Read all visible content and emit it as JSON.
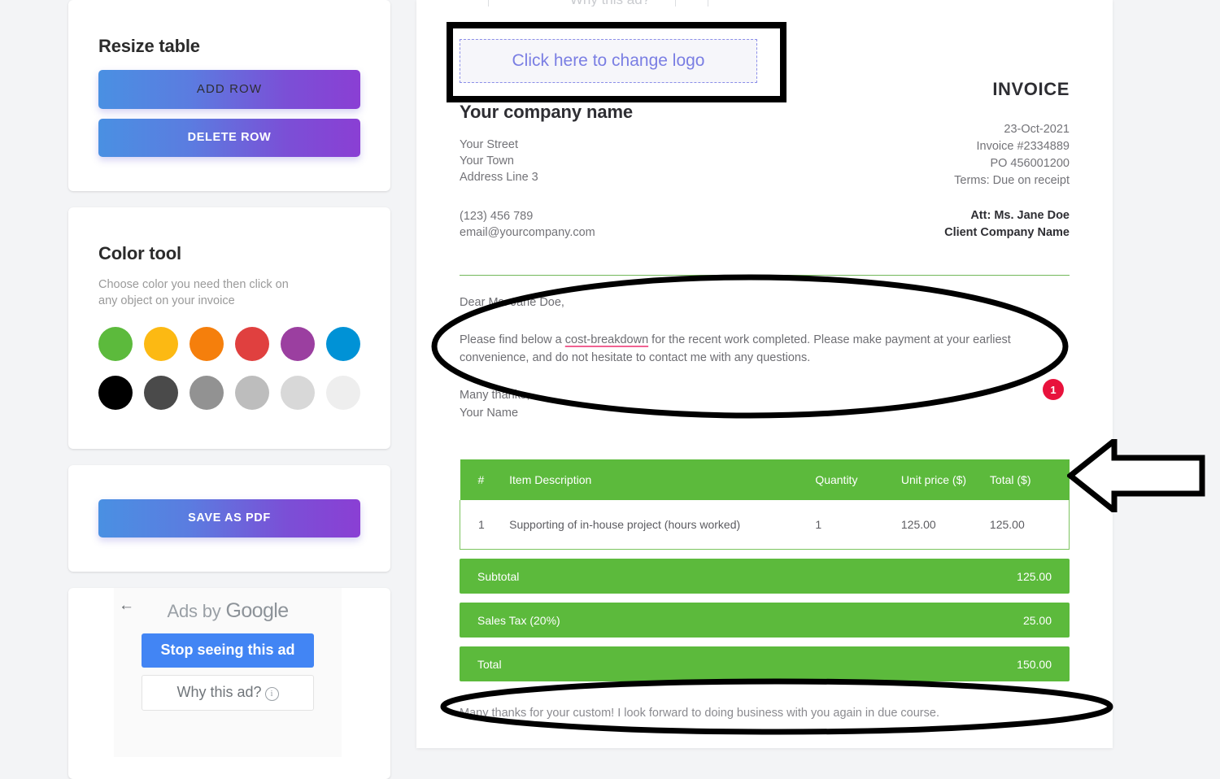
{
  "sidebar": {
    "resize_panel": {
      "title": "Resize table",
      "add_row_label": "ADD ROW",
      "delete_row_label": "DELETE ROW"
    },
    "color_panel": {
      "title": "Color tool",
      "subtitle": "Choose color you need then click on any object on your invoice",
      "swatches": [
        {
          "name": "green",
          "hex": "#5cba3c"
        },
        {
          "name": "yellow",
          "hex": "#fcb913"
        },
        {
          "name": "orange",
          "hex": "#f57f0c"
        },
        {
          "name": "red",
          "hex": "#e0403f"
        },
        {
          "name": "purple",
          "hex": "#9b3fa0"
        },
        {
          "name": "blue",
          "hex": "#0092d6"
        },
        {
          "name": "black",
          "hex": "#000000"
        },
        {
          "name": "dark-gray",
          "hex": "#4a4a4a"
        },
        {
          "name": "gray",
          "hex": "#929292"
        },
        {
          "name": "light-gray",
          "hex": "#bdbdbd"
        },
        {
          "name": "lighter-gray",
          "hex": "#d8d8d8"
        },
        {
          "name": "near-white",
          "hex": "#eeeeee"
        }
      ]
    },
    "save_panel": {
      "save_as_pdf_label": "SAVE AS PDF"
    },
    "ad_panel": {
      "back_arrow": "←",
      "ads_by_prefix": "Ads by ",
      "ads_by_brand": "Google",
      "stop_seeing_label": "Stop seeing this ad",
      "why_this_ad_label": "Why this ad?",
      "info_glyph": "i"
    }
  },
  "top_ghost_text": "Why this ad?",
  "invoice": {
    "logo_placeholder": "Click here to change logo",
    "company_name": "Your company name",
    "address_lines": [
      "Your Street",
      "Your Town",
      "Address Line 3"
    ],
    "contact_lines": [
      "(123) 456 789",
      "email@yourcompany.com"
    ],
    "heading": "INVOICE",
    "meta_lines": [
      "23-Oct-2021",
      "Invoice #2334889",
      "PO 456001200",
      "Terms: Due on receipt"
    ],
    "attention_lines": [
      "Att: Ms. Jane Doe",
      "Client Company Name"
    ],
    "letter": {
      "salutation": "Dear Ms. Jane Doe,",
      "body_before": "Please find below a ",
      "body_misspelled": "cost-breakdown",
      "body_after": " for the recent work completed. Please make payment at your earliest convenience, and do not hesitate to contact me with any questions.",
      "signoff": "Many thanks,",
      "signature": "Your Name"
    },
    "table": {
      "headers": [
        "#",
        "Item Description",
        "Quantity",
        "Unit price ($)",
        "Total ($)"
      ],
      "rows": [
        {
          "num": "1",
          "description": "Supporting of in-house project (hours worked)",
          "quantity": "1",
          "unit_price": "125.00",
          "total": "125.00"
        }
      ]
    },
    "totals": [
      {
        "label": "Subtotal",
        "value": "125.00"
      },
      {
        "label": "Sales Tax (20%)",
        "value": "25.00"
      },
      {
        "label": "Total",
        "value": "150.00"
      }
    ],
    "footer_note": "Many thanks for your custom! I look forward to doing business with you again in due course.",
    "accent_color": "#5cba3c"
  },
  "annotations": {
    "badge_number": "1"
  }
}
